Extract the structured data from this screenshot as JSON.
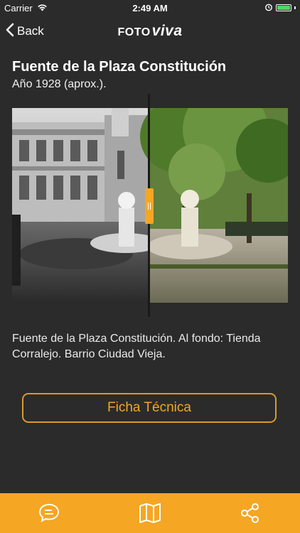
{
  "status_bar": {
    "carrier": "Carrier",
    "time": "2:49 AM"
  },
  "nav": {
    "back_label": "Back",
    "logo_foto": "FOTO",
    "logo_viva": "viva"
  },
  "photo": {
    "title": "Fuente de la Plaza Constitución",
    "year": "Año 1928 (aprox.).",
    "description": "Fuente de la Plaza Constitución. Al fondo: Tienda Corralejo. Barrio Ciudad Vieja."
  },
  "actions": {
    "ficha_label": "Ficha Técnica"
  },
  "tabs": [
    {
      "icon": "chat-icon"
    },
    {
      "icon": "map-icon"
    },
    {
      "icon": "share-icon"
    }
  ],
  "colors": {
    "background": "#2b2b2b",
    "accent": "#f5a623",
    "battery": "#4cd964"
  }
}
